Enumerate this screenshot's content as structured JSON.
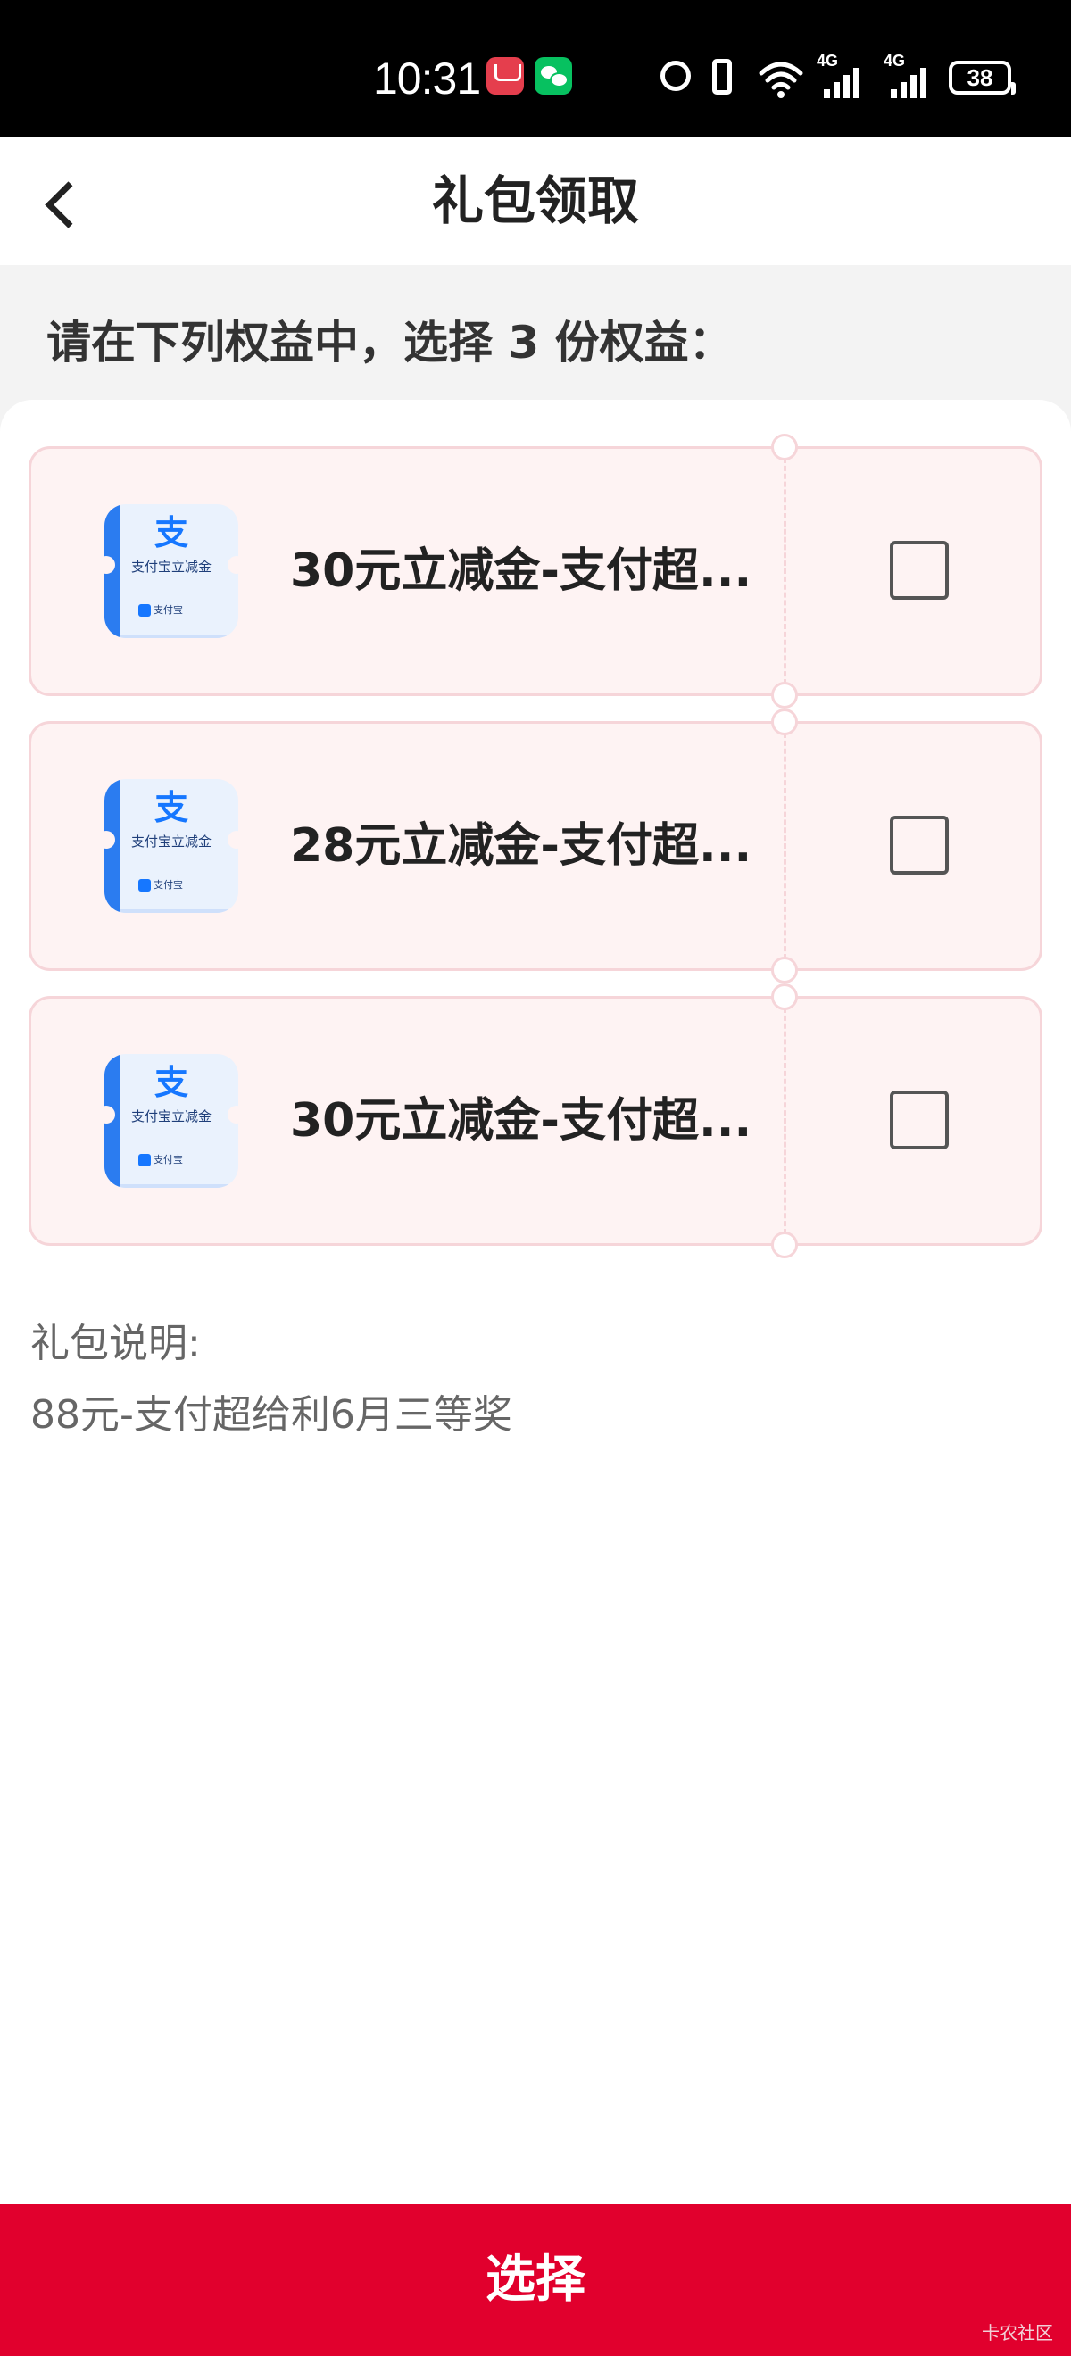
{
  "status_bar": {
    "time": "10:31",
    "apps": [
      "app-gallery-icon",
      "wechat-icon"
    ],
    "signal1_label": "4G",
    "signal2_label": "4G",
    "battery": "38"
  },
  "nav": {
    "back_icon": "chevron-left-icon",
    "title": "礼包领取"
  },
  "instruction": "请在下列权益中，选择 3 份权益：",
  "coupons": [
    {
      "image": {
        "logo_char": "支",
        "caption": "支付宝立减金",
        "brand": "支付宝"
      },
      "title": "30元立减金-支付超...",
      "checked": false
    },
    {
      "image": {
        "logo_char": "支",
        "caption": "支付宝立减金",
        "brand": "支付宝"
      },
      "title": "28元立减金-支付超...",
      "checked": false
    },
    {
      "image": {
        "logo_char": "支",
        "caption": "支付宝立减金",
        "brand": "支付宝"
      },
      "title": "30元立减金-支付超...",
      "checked": false
    }
  ],
  "description": {
    "label": "礼包说明:",
    "text": "88元-支付超给利6月三等奖"
  },
  "select_button": "选择",
  "watermark": "卡农社区",
  "colors": {
    "primary": "#e1002d",
    "coupon_bg": "#fef3f3",
    "coupon_border": "#f6d5d9",
    "alipay_blue": "#1677ff"
  }
}
